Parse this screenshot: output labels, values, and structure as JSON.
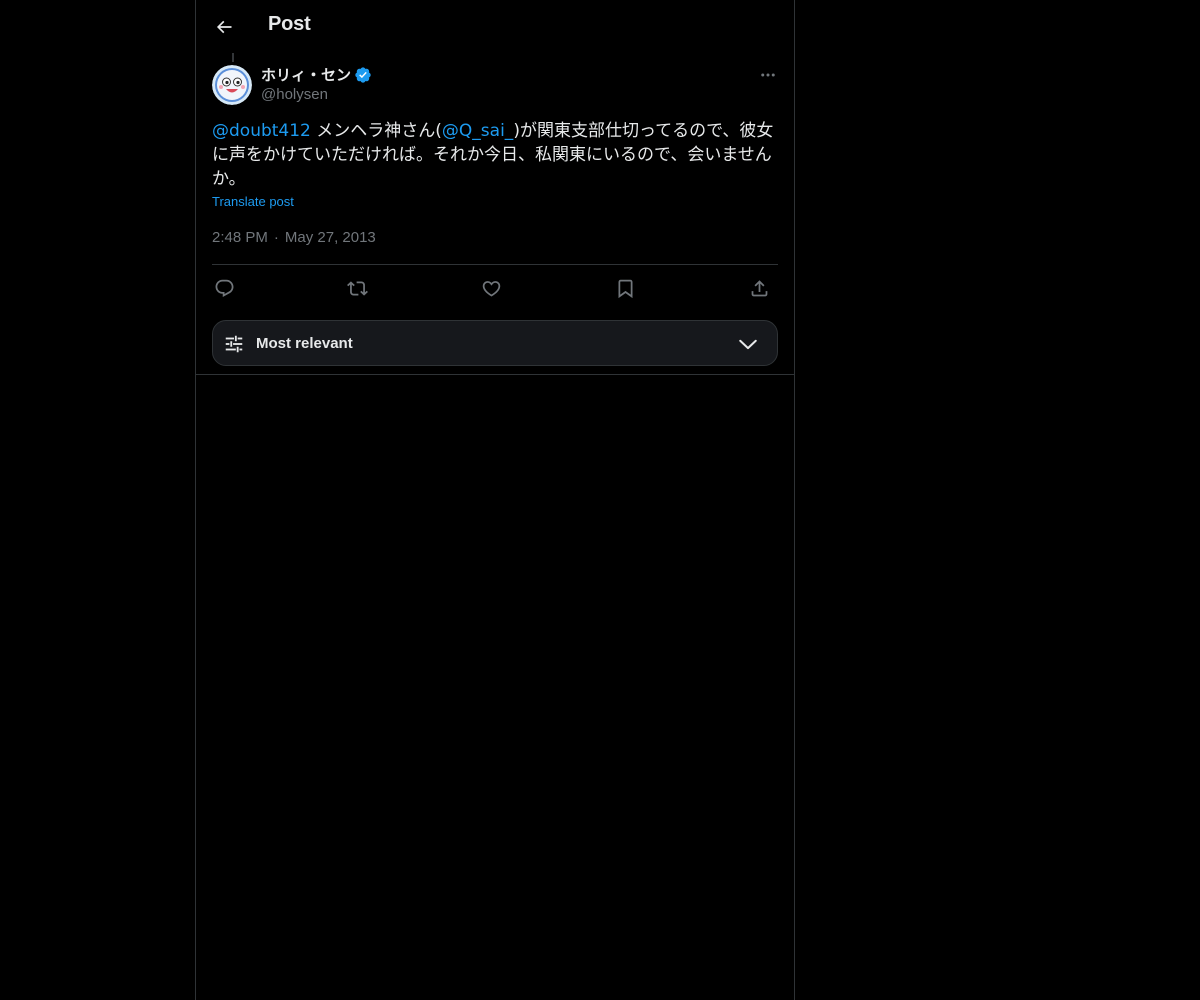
{
  "header": {
    "title": "Post",
    "back_icon": "arrow-left-icon"
  },
  "author": {
    "display_name": "ホリィ・セン",
    "handle": "@holysen",
    "verified": true,
    "verified_color": "#1d9bf0"
  },
  "post": {
    "segments": [
      {
        "type": "mention",
        "text": "@doubt412"
      },
      {
        "type": "text",
        "text": " メンヘラ神さん("
      },
      {
        "type": "mention",
        "text": "@Q_sai_"
      },
      {
        "type": "text",
        "text": ")が関東支部仕切ってるので、彼女に声をかけていただければ。それか今日、私関東にいるので、会いませんか。"
      }
    ],
    "translate_label": "Translate post",
    "time": "2:48 PM",
    "separator": "·",
    "date": "May 27, 2013"
  },
  "actions": [
    "reply-icon",
    "repost-icon",
    "like-icon",
    "bookmark-icon",
    "share-icon"
  ],
  "sort": {
    "label": "Most relevant",
    "icon": "sliders-icon",
    "chevron": "chevron-down-icon"
  },
  "colors": {
    "background": "#000000",
    "text": "#e7e9ea",
    "muted": "#71767b",
    "accent": "#1d9bf0",
    "border": "#2f3336"
  }
}
